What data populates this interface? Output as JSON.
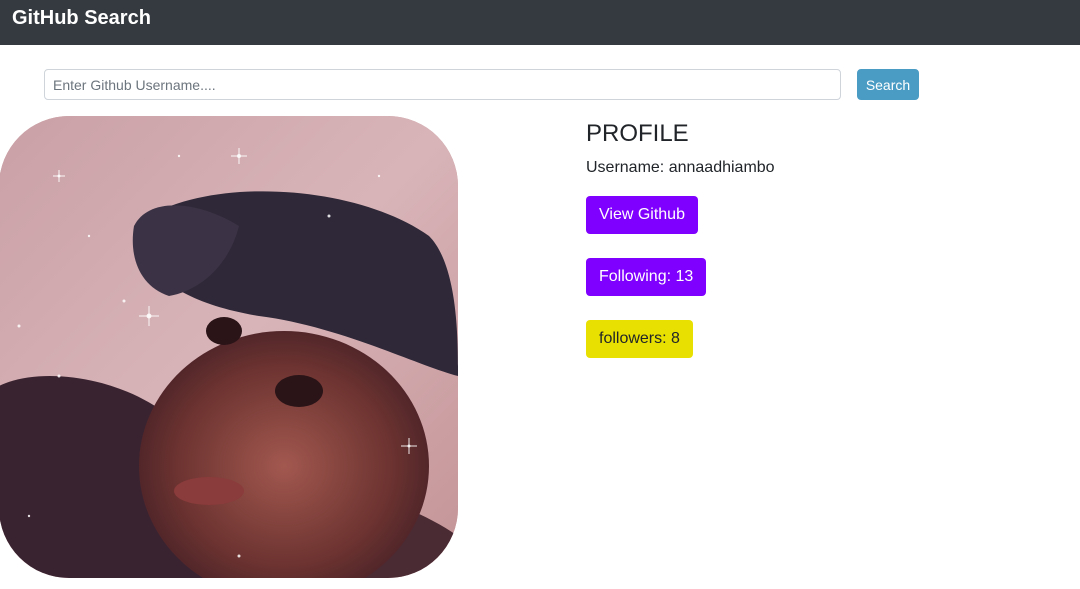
{
  "navbar": {
    "brand": "GitHub Search"
  },
  "search": {
    "placeholder": "Enter Github Username....",
    "value": "",
    "button_label": "Search"
  },
  "profile": {
    "heading": "PROFILE",
    "username_label": "Username: annaadhiambo",
    "view_github_label": "View Github",
    "following_label": "Following: 13",
    "followers_label": "followers: 8"
  },
  "colors": {
    "navbar_bg": "#343a40",
    "search_button": "#4a9cc4",
    "accent_purple": "#8000ff",
    "accent_yellow": "#e8e000"
  }
}
